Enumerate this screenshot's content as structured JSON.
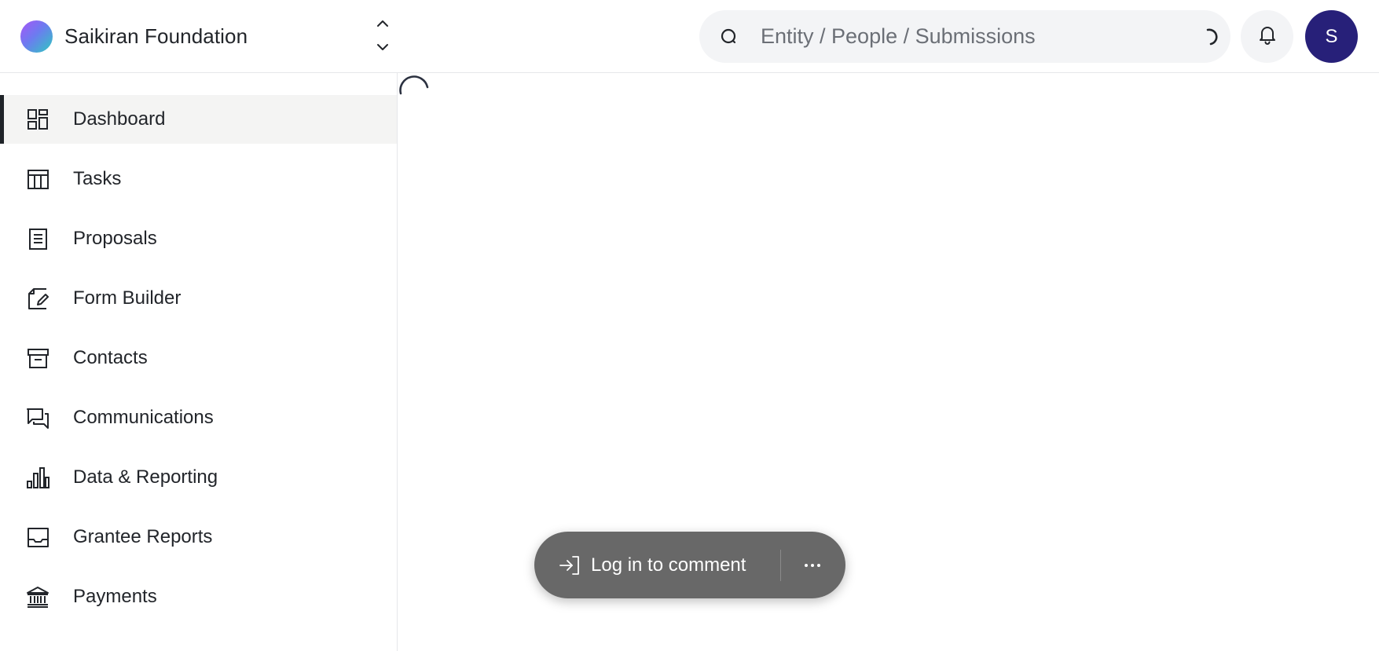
{
  "header": {
    "org_name": "Saikiran Foundation",
    "org_switch_icon": "chevron-up-down-icon",
    "search": {
      "placeholder": "Entity / People / Submissions",
      "value": ""
    },
    "notifications_icon": "bell-icon",
    "avatar_initial": "S",
    "avatar_color": "#272079"
  },
  "sidebar": {
    "active_index": 0,
    "items": [
      {
        "label": "Dashboard",
        "icon": "dashboard-icon"
      },
      {
        "label": "Tasks",
        "icon": "table-icon"
      },
      {
        "label": "Proposals",
        "icon": "document-icon"
      },
      {
        "label": "Form Builder",
        "icon": "edit-page-icon"
      },
      {
        "label": "Contacts",
        "icon": "archive-icon"
      },
      {
        "label": "Communications",
        "icon": "chat-icon"
      },
      {
        "label": "Data & Reporting",
        "icon": "bar-chart-icon"
      },
      {
        "label": "Grantee Reports",
        "icon": "inbox-icon"
      },
      {
        "label": "Payments",
        "icon": "bank-icon"
      }
    ]
  },
  "main": {
    "loading": true
  },
  "comment_bar": {
    "login_label": "Log in to comment",
    "login_icon": "sign-in-icon",
    "more_icon": "more-horizontal-icon"
  }
}
